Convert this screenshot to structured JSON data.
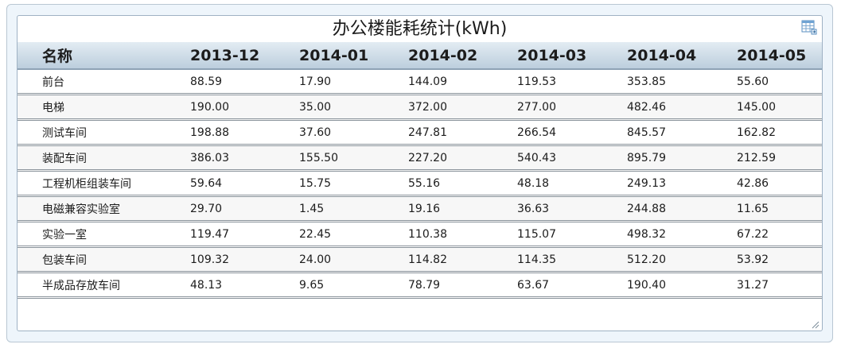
{
  "panel": {
    "title": "办公楼能耗统计(kWh)",
    "export_icon": "table-export-icon"
  },
  "table": {
    "columns": [
      "名称",
      "2013-12",
      "2014-01",
      "2014-02",
      "2014-03",
      "2014-04",
      "2014-05"
    ],
    "rows": [
      [
        "前台",
        "88.59",
        "17.90",
        "144.09",
        "119.53",
        "353.85",
        "55.60"
      ],
      [
        "电梯",
        "190.00",
        "35.00",
        "372.00",
        "277.00",
        "482.46",
        "145.00"
      ],
      [
        "测试车间",
        "198.88",
        "37.60",
        "247.81",
        "266.54",
        "845.57",
        "162.82"
      ],
      [
        "装配车间",
        "386.03",
        "155.50",
        "227.20",
        "540.43",
        "895.79",
        "212.59"
      ],
      [
        "工程机柜组装车间",
        "59.64",
        "15.75",
        "55.16",
        "48.18",
        "249.13",
        "42.86"
      ],
      [
        "电磁兼容实验室",
        "29.70",
        "1.45",
        "19.16",
        "36.63",
        "244.88",
        "11.65"
      ],
      [
        "实验一室",
        "119.47",
        "22.45",
        "110.38",
        "115.07",
        "498.32",
        "67.22"
      ],
      [
        "包装车间",
        "109.32",
        "24.00",
        "114.82",
        "114.35",
        "512.20",
        "53.92"
      ],
      [
        "半成品存放车间",
        "48.13",
        "9.65",
        "78.79",
        "63.67",
        "190.40",
        "31.27"
      ]
    ]
  },
  "colors": {
    "header_top": "#e3ecf3",
    "header_bottom": "#bccedd",
    "row_alt": "#f7f7f7",
    "frame_bg": "#eef5fb"
  }
}
